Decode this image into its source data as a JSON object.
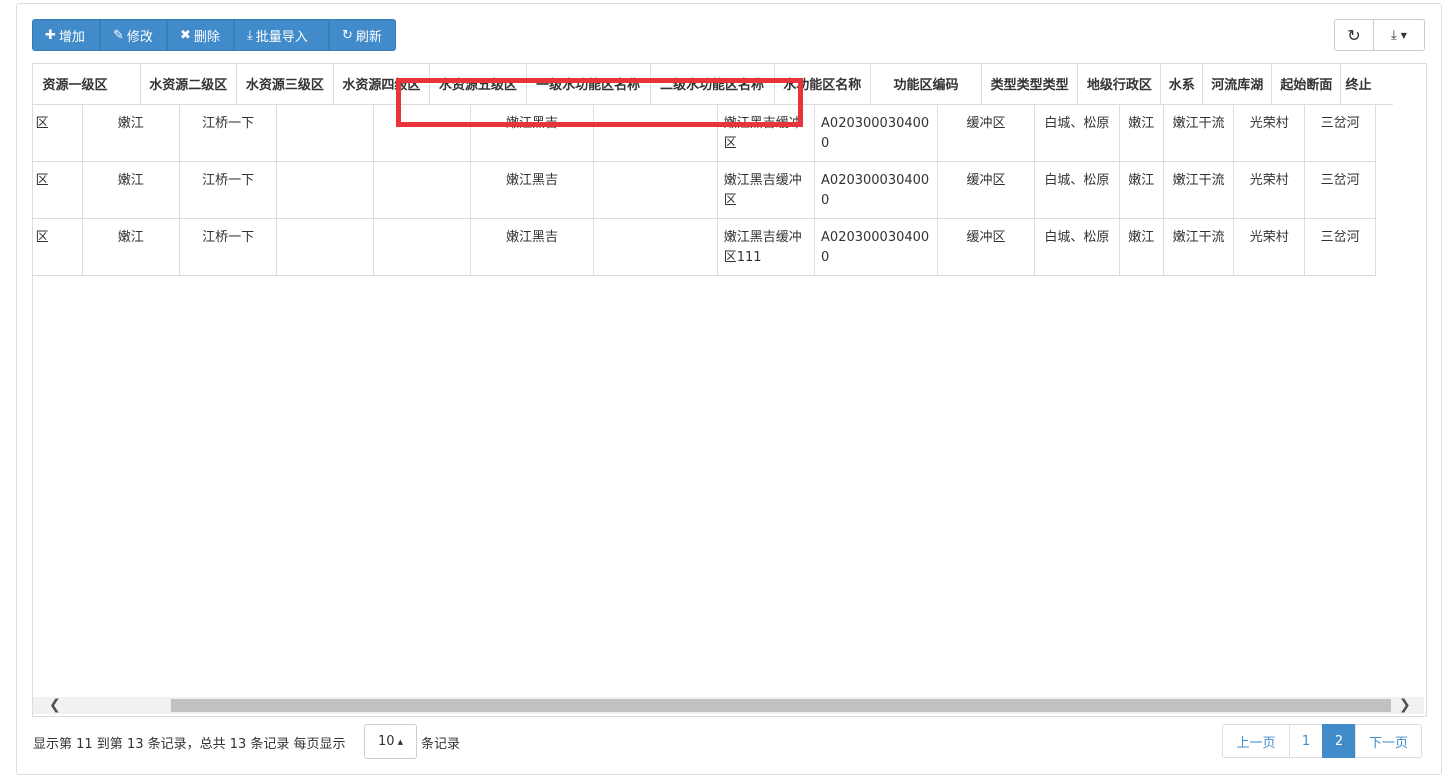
{
  "toolbar": {
    "add_label": "增加",
    "edit_label": "修改",
    "delete_label": "删除",
    "import_label": "批量导入",
    "refresh_label": "刷新"
  },
  "table": {
    "headers": [
      "水资源一级区",
      "水资源二级区",
      "水资源三级区",
      "水资源四级区",
      "水资源五级区",
      "一级水功能区名称",
      "二级水功能区名称",
      "水功能区名称",
      "功能区编码",
      "类型类型类型",
      "地级行政区",
      "水系",
      "河流库湖",
      "起始断面",
      "终止断面"
    ],
    "header_visible": [
      "资源一级区",
      "水资源二级区",
      "水资源三级区",
      "水资源四级区",
      "水资源五级区",
      "一级水功能区名称",
      "二级水功能区名称",
      "水功能区名称",
      "功能区编码",
      "类型类型类型",
      "地级行政区",
      "水系",
      "河流库湖",
      "起始断面",
      "终止"
    ],
    "rows": [
      [
        "区",
        "嫩江",
        "江桥一下",
        "",
        "",
        "嫩江黑吉",
        "",
        "嫩江黑吉缓冲区",
        "A0203000304000",
        "缓冲区",
        "白城、松原",
        "嫩江",
        "嫩江干流",
        "光荣村",
        "三岔河"
      ],
      [
        "区",
        "嫩江",
        "江桥一下",
        "",
        "",
        "嫩江黑吉",
        "",
        "嫩江黑吉缓冲区",
        "A0203000304000",
        "缓冲区",
        "白城、松原",
        "嫩江",
        "嫩江干流",
        "光荣村",
        "三岔河"
      ],
      [
        "区",
        "嫩江",
        "江桥一下",
        "",
        "",
        "嫩江黑吉",
        "",
        "嫩江黑吉缓冲区111",
        "A0203000304000",
        "缓冲区",
        "白城、松原",
        "嫩江",
        "嫩江干流",
        "光荣村",
        "三岔河"
      ]
    ]
  },
  "pager": {
    "info": "显示第 11 到第 13 条记录，总共 13 条记录 每页显示",
    "page_size": "10",
    "suffix": "条记录",
    "prev": "上一页",
    "pages": [
      "1",
      "2"
    ],
    "active_page": "2",
    "next": "下一页"
  },
  "colors": {
    "primary": "#428bca",
    "highlight": "#e8333a"
  }
}
